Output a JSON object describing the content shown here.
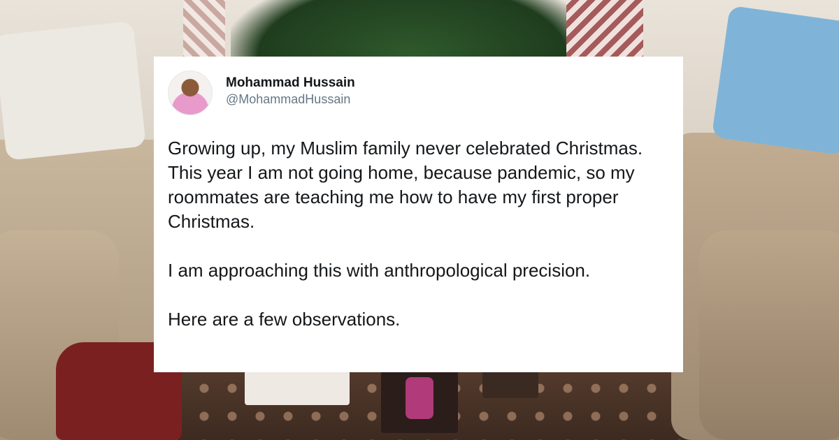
{
  "tweet": {
    "display_name": "Mohammad Hussain",
    "handle": "@MohammadHussain",
    "paragraphs": [
      "Growing up, my Muslim family never celebrated Christmas. This year I am not going home, because pandemic, so my roommates are teaching me how to have my first proper Christmas.",
      "I am approaching this with anthropological precision.",
      "Here are a few observations."
    ],
    "avatar_icon": "profile-photo",
    "colors": {
      "card_background": "#ffffff",
      "text_primary": "#14171a",
      "text_secondary": "#657786"
    }
  }
}
